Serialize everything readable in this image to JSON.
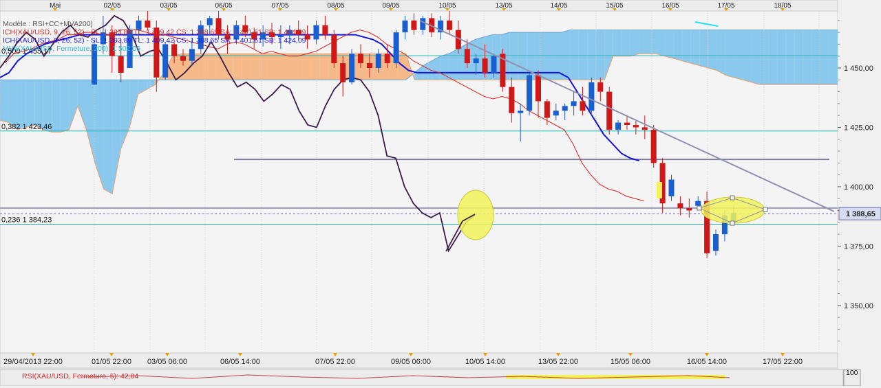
{
  "chart_data": {
    "type": "candlestick",
    "instrument": "XAU/USD",
    "top_axis_labels": [
      "Mai",
      "02/05",
      "03/05",
      "06/05",
      "07/05",
      "08/05",
      "09/05",
      "10/05",
      "13/05",
      "14/05",
      "15/05",
      "16/05",
      "17/05",
      "18/05"
    ],
    "bottom_axis_labels": [
      "29/04/2013 22:00",
      "01/05 22:00",
      "03/05 06:00",
      "06/05 14:00",
      "07/05 22:00",
      "09/05 06:00",
      "10/05 14:00",
      "13/05 22:00",
      "15/05 06:00",
      "16/05 14:00",
      "17/05 22:00"
    ],
    "y_ticks": [
      1350,
      1375,
      1400,
      1425,
      1450
    ],
    "y_tick_labels": [
      "1 350,00",
      "1 375,00",
      "1 400,00",
      "1 425,00",
      "1 450,00"
    ],
    "ylim": [
      1330,
      1474
    ],
    "current_price": 1388.65,
    "current_price_label": "1 388,65",
    "legend": [
      {
        "text": "Modèle : RSI+CC+MVA200]",
        "color": "#555555"
      },
      {
        "text": "ICH(XAU/USD, 9, 26, 52) - SL: 1 393,89  TL: 1 409,42  CS: 1 388,65  SA: 1 401,61  SB: 1 424,09",
        "color": "#d62828"
      },
      {
        "text": "ICH(XAU/USD, 9, 26, 52) - SL: 1 393,89  TL: 1 409,42  CS: 1 388,65  SA: 1 401,61  SB: 1 424,09",
        "color": "#1a1aff"
      },
      {
        "text": "MVA(XAU/USD, Fermeture, 200): 1 502,05",
        "color": "#22bbdd"
      }
    ],
    "fib_levels": [
      {
        "label": "0,500 1 455,17",
        "value": 1455.17
      },
      {
        "label": "0,382 1 423,46",
        "value": 1423.46
      },
      {
        "label": "0,236 1 384,23",
        "value": 1384.23
      }
    ],
    "horizontal_lines": [
      1411.5,
      1391.0
    ],
    "candles": [
      [
        1443,
        1462,
        1443,
        1460
      ],
      [
        1460,
        1472,
        1456,
        1465
      ],
      [
        1465,
        1468,
        1448,
        1455
      ],
      [
        1455,
        1462,
        1444,
        1448
      ],
      [
        1450,
        1468,
        1450,
        1466
      ],
      [
        1466,
        1472,
        1462,
        1470
      ],
      [
        1470,
        1474,
        1466,
        1467
      ],
      [
        1467,
        1470,
        1440,
        1446
      ],
      [
        1446,
        1461,
        1445,
        1460
      ],
      [
        1460,
        1462,
        1452,
        1455
      ],
      [
        1455,
        1458,
        1451,
        1453
      ],
      [
        1453,
        1462,
        1451,
        1458
      ],
      [
        1458,
        1470,
        1456,
        1468
      ],
      [
        1468,
        1472,
        1464,
        1471
      ],
      [
        1471,
        1474,
        1462,
        1464
      ],
      [
        1464,
        1468,
        1456,
        1462
      ],
      [
        1462,
        1470,
        1460,
        1468
      ],
      [
        1468,
        1472,
        1463,
        1465
      ],
      [
        1465,
        1467,
        1458,
        1462
      ],
      [
        1462,
        1468,
        1459,
        1465
      ],
      [
        1465,
        1469,
        1460,
        1463
      ],
      [
        1463,
        1468,
        1458,
        1464
      ],
      [
        1464,
        1468,
        1460,
        1466
      ],
      [
        1466,
        1470,
        1462,
        1464
      ],
      [
        1464,
        1468,
        1458,
        1462
      ],
      [
        1462,
        1470,
        1460,
        1468
      ],
      [
        1468,
        1472,
        1462,
        1464
      ],
      [
        1464,
        1466,
        1450,
        1452
      ],
      [
        1452,
        1455,
        1438,
        1444
      ],
      [
        1444,
        1458,
        1443,
        1456
      ],
      [
        1456,
        1460,
        1450,
        1452
      ],
      [
        1452,
        1456,
        1446,
        1450
      ],
      [
        1450,
        1458,
        1448,
        1456
      ],
      [
        1456,
        1460,
        1450,
        1452
      ],
      [
        1452,
        1466,
        1450,
        1465
      ],
      [
        1465,
        1472,
        1462,
        1470
      ],
      [
        1470,
        1473,
        1464,
        1466
      ],
      [
        1466,
        1472,
        1464,
        1471
      ],
      [
        1471,
        1473,
        1463,
        1465
      ],
      [
        1465,
        1472,
        1462,
        1470
      ],
      [
        1470,
        1474,
        1464,
        1466
      ],
      [
        1466,
        1470,
        1456,
        1458
      ],
      [
        1458,
        1462,
        1450,
        1452
      ],
      [
        1452,
        1456,
        1447,
        1454
      ],
      [
        1454,
        1460,
        1446,
        1448
      ],
      [
        1448,
        1456,
        1446,
        1455
      ],
      [
        1456,
        1458,
        1440,
        1442
      ],
      [
        1442,
        1446,
        1427,
        1431
      ],
      [
        1431,
        1435,
        1419,
        1432
      ],
      [
        1432,
        1448,
        1430,
        1447
      ],
      [
        1447,
        1449,
        1429,
        1436
      ],
      [
        1436,
        1437,
        1426,
        1429
      ],
      [
        1430,
        1435,
        1428,
        1432
      ],
      [
        1432,
        1435,
        1428,
        1434
      ],
      [
        1434,
        1440,
        1430,
        1436
      ],
      [
        1436,
        1442,
        1430,
        1432
      ],
      [
        1432,
        1446,
        1430,
        1444
      ],
      [
        1444,
        1446,
        1436,
        1440
      ],
      [
        1440,
        1442,
        1422,
        1424
      ],
      [
        1424,
        1428,
        1422,
        1427
      ],
      [
        1427,
        1430,
        1424,
        1426
      ],
      [
        1426,
        1428,
        1422,
        1425
      ],
      [
        1425,
        1430,
        1420,
        1424
      ],
      [
        1424,
        1426,
        1408,
        1410
      ],
      [
        1410,
        1412,
        1389,
        1393
      ],
      [
        1396,
        1405,
        1394,
        1403
      ],
      [
        1393,
        1396,
        1388,
        1391
      ],
      [
        1391,
        1395,
        1387,
        1390
      ],
      [
        1392,
        1396,
        1390,
        1394
      ],
      [
        1394,
        1398,
        1370,
        1372
      ],
      [
        1373,
        1382,
        1371,
        1380
      ],
      [
        1380,
        1390,
        1377,
        1388
      ],
      [
        1385,
        1392,
        1384,
        1389
      ]
    ],
    "tenkan_line": [
      1452,
      1456,
      1457,
      1458,
      1460,
      1461,
      1462,
      1464,
      1464,
      1465,
      1465,
      1464,
      1464,
      1466,
      1466,
      1466,
      1465,
      1464,
      1464,
      1463,
      1462,
      1461,
      1460,
      1459,
      1458,
      1460,
      1461,
      1460,
      1458,
      1456,
      1457,
      1456,
      1455,
      1455,
      1456,
      1457,
      1459,
      1461,
      1463,
      1465,
      1466,
      1465,
      1463,
      1460,
      1458,
      1456,
      1453,
      1451,
      1449,
      1448,
      1446,
      1444,
      1442,
      1440,
      1438,
      1437,
      1438,
      1437,
      1435,
      1432,
      1430,
      1428,
      1426,
      1424,
      1418,
      1410,
      1405,
      1401,
      1399,
      1398,
      1396,
      1395,
      1394
    ],
    "kijun_line": [
      1446,
      1448,
      1453,
      1456,
      1458,
      1460,
      1461,
      1462,
      1463,
      1464,
      1464,
      1464,
      1464,
      1464,
      1464,
      1464,
      1464,
      1464,
      1464,
      1464,
      1464,
      1464,
      1464,
      1464,
      1464,
      1464,
      1464,
      1464,
      1464,
      1464,
      1464,
      1464,
      1464,
      1464,
      1464,
      1464,
      1464,
      1464,
      1464,
      1464,
      1464,
      1463,
      1462,
      1460,
      1456,
      1452,
      1449,
      1448,
      1448,
      1448,
      1448,
      1448,
      1448,
      1448,
      1448,
      1448,
      1448,
      1448,
      1448,
      1448,
      1448,
      1448,
      1448,
      1448,
      1446,
      1440,
      1434,
      1428,
      1422,
      1418,
      1414,
      1412,
      1411
    ],
    "chikou_line": [
      1450,
      1455,
      1461,
      1465,
      1462,
      1455,
      1460,
      1465,
      1468,
      1464,
      1463,
      1466,
      1468,
      1472,
      1470,
      1464,
      1455,
      1457,
      1458,
      1452,
      1445,
      1448,
      1452,
      1455,
      1461,
      1455,
      1448,
      1442,
      1444,
      1441,
      1436,
      1439,
      1443,
      1441,
      1432,
      1426,
      1425,
      1434,
      1441,
      1445,
      1446,
      1445,
      1440,
      1430,
      1413,
      1412,
      1400,
      1393,
      1389,
      1387,
      1389,
      1373,
      1379,
      1385,
      1388
    ],
    "cloud_span_a": [
      1428,
      1427,
      1424,
      1425,
      1426,
      1424,
      1423,
      1423,
      1424,
      1434,
      1424,
      1410,
      1399,
      1397,
      1416,
      1425,
      1439,
      1441,
      1443,
      1448,
      1455,
      1456,
      1456,
      1456,
      1456,
      1456,
      1456,
      1456,
      1456,
      1456,
      1456,
      1456,
      1456,
      1456,
      1456,
      1456,
      1456,
      1456,
      1456,
      1456,
      1456,
      1456,
      1456,
      1456,
      1456,
      1456,
      1456,
      1456,
      1445,
      1445,
      1445,
      1445,
      1445,
      1445,
      1445,
      1445,
      1445,
      1445,
      1445,
      1445,
      1445,
      1445,
      1445,
      1445,
      1445,
      1445,
      1445,
      1445,
      1445,
      1445,
      1445,
      1455,
      1455,
      1455,
      1456,
      1456,
      1456,
      1455,
      1454,
      1453,
      1452,
      1451,
      1450,
      1449,
      1447,
      1446,
      1445,
      1444,
      1443,
      1443,
      1443,
      1443,
      1443,
      1443,
      1443,
      1443,
      1443,
      1443
    ],
    "cloud_span_b": [
      1445,
      1445,
      1445,
      1445,
      1445,
      1445,
      1445,
      1445,
      1445,
      1445,
      1445,
      1445,
      1445,
      1445,
      1445,
      1445,
      1445,
      1445,
      1445,
      1445,
      1445,
      1445,
      1445,
      1445,
      1445,
      1445,
      1445,
      1445,
      1445,
      1445,
      1445,
      1445,
      1445,
      1445,
      1445,
      1445,
      1445,
      1445,
      1445,
      1445,
      1445,
      1445,
      1445,
      1445,
      1445,
      1445,
      1445,
      1445,
      1448,
      1451,
      1453,
      1455,
      1456,
      1458,
      1460,
      1462,
      1463,
      1464,
      1464,
      1465,
      1465,
      1465,
      1465,
      1465,
      1465,
      1465,
      1466,
      1466,
      1466,
      1466,
      1466,
      1466,
      1466,
      1466,
      1466,
      1466,
      1466,
      1466,
      1466,
      1466,
      1466,
      1466,
      1466,
      1466,
      1466,
      1466,
      1466,
      1466,
      1466,
      1466,
      1466,
      1466,
      1466,
      1466,
      1466,
      1466,
      1466,
      1466
    ],
    "rsi_label": "RSI(XAU/USD, Fermeture, 5): 42,04",
    "rsi_axis_label": "100",
    "colors": {
      "bullish": "#1a5fd0",
      "bearish": "#d01818",
      "doji": "#6a2222",
      "cloud_bull": "#7ec4ec",
      "cloud_bear": "#f5b27e",
      "tenkan": "#e02020",
      "kijun": "#1414e0",
      "chikou": "#3a1a4a",
      "fib": "#20b0b0",
      "trendline": "#9090b0",
      "highlight": "#f2f25a",
      "mva": "#22e0f0"
    }
  }
}
